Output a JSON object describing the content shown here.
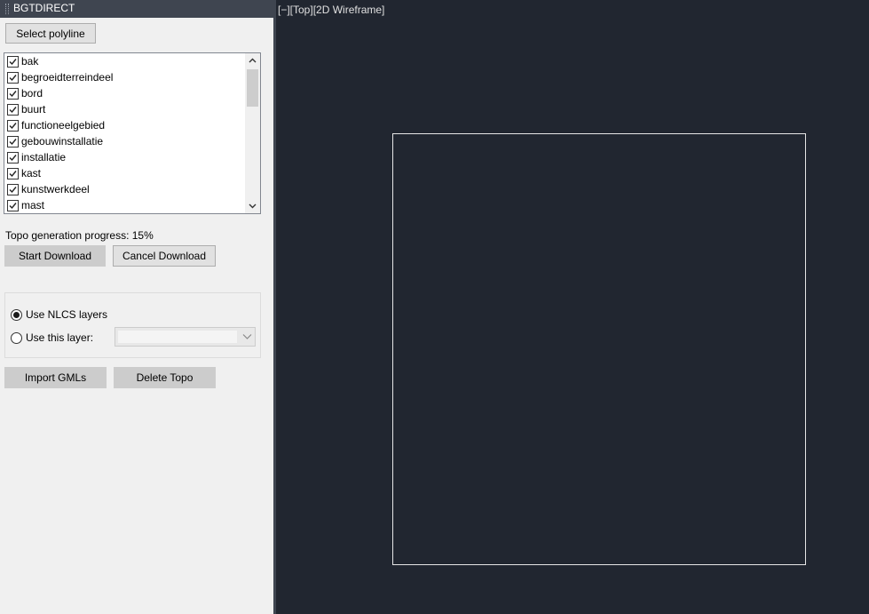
{
  "panel": {
    "title": "BGTDIRECT",
    "select_polyline_label": "Select polyline",
    "layers": [
      {
        "label": "bak",
        "checked": true
      },
      {
        "label": "begroeidterreindeel",
        "checked": true
      },
      {
        "label": "bord",
        "checked": true
      },
      {
        "label": "buurt",
        "checked": true
      },
      {
        "label": "functioneelgebied",
        "checked": true
      },
      {
        "label": "gebouwinstallatie",
        "checked": true
      },
      {
        "label": "installatie",
        "checked": true
      },
      {
        "label": "kast",
        "checked": true
      },
      {
        "label": "kunstwerkdeel",
        "checked": true
      },
      {
        "label": "mast",
        "checked": true
      }
    ],
    "progress_text": "Topo generation progress: 15%",
    "start_download_label": "Start Download",
    "cancel_download_label": "Cancel Download",
    "layer_options": {
      "use_nlcs_label": "Use NLCS layers",
      "use_nlcs_selected": true,
      "use_this_layer_label": "Use this layer:",
      "use_this_layer_selected": false,
      "layer_value": ""
    },
    "import_gmls_label": "Import GMLs",
    "delete_topo_label": "Delete Topo"
  },
  "viewport": {
    "controls_label": "[−][Top][2D Wireframe]"
  },
  "colors": {
    "viewport_background": "#212630",
    "panel_background": "#f0f0f0",
    "title_bar": "#3f4550",
    "drawing_line": "#e6e6e6"
  }
}
